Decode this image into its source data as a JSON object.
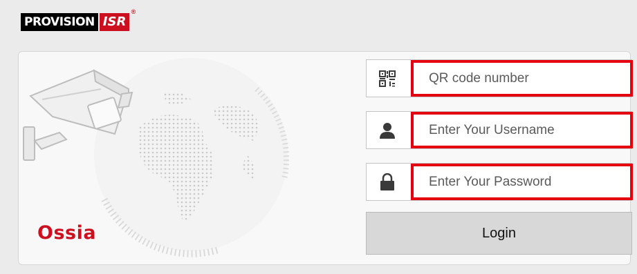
{
  "header": {
    "logo_left": "PROVISION",
    "logo_right": "ISR",
    "logo_reg": "®"
  },
  "brand": {
    "name": "Ossia"
  },
  "form": {
    "qr": {
      "placeholder": "QR code number",
      "value": "",
      "icon": "qr-code-icon"
    },
    "username": {
      "placeholder": "Enter Your Username",
      "value": "",
      "icon": "user-icon"
    },
    "password": {
      "placeholder": "Enter Your Password",
      "value": "",
      "icon": "lock-icon"
    },
    "login_label": "Login"
  },
  "colors": {
    "accent_red": "#cc1020",
    "highlight_border": "#e4000f",
    "background": "#ebebeb"
  }
}
